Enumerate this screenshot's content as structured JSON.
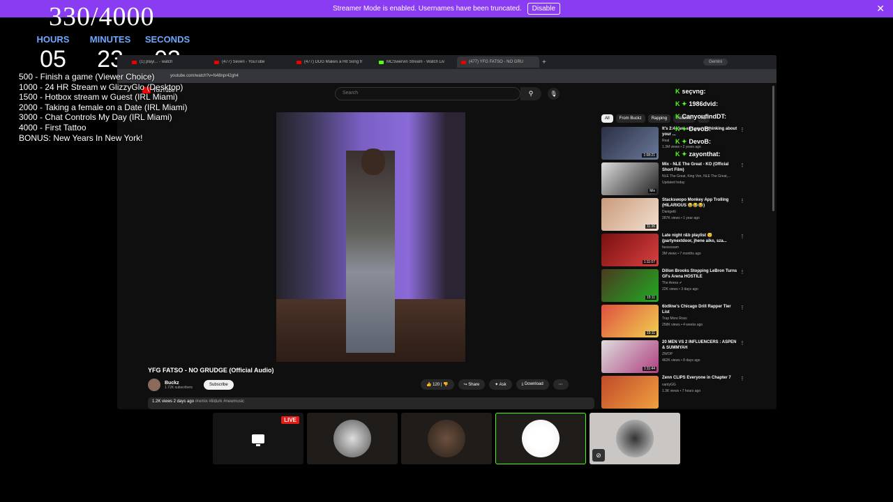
{
  "banner": {
    "text": "Streamer Mode is enabled. Usernames have been truncated.",
    "button": "Disable",
    "close": "✕"
  },
  "goal": {
    "text": "330/4000"
  },
  "timer": {
    "hours_label": "HOURS",
    "minutes_label": "MINUTES",
    "seconds_label": "SECONDS",
    "hours": "05",
    "minutes": "23",
    "seconds": "03"
  },
  "goals": [
    "500 -  Finish a game (Viewer Choice)",
    "1000 - 24 HR Stream w GlizzyGlo (Desktop)",
    "1500 - Hotbox stream w Guest (IRL Miami)",
    "2000 - Taking a female on a Date (IRL Miami)",
    "3000 - Chat Controls My Day (IRL Miami)",
    "4000 - First Tattoo",
    "BONUS: New Years In New York!"
  ],
  "browser": {
    "tabs": [
      "(1) playi... - watch",
      "(477) Seven - YouTube",
      "(477) DDG Makes a Hit Song fr",
      "MCSwervin Stream - Watch Liv",
      "(477) YFG FATSO - NO GRU"
    ],
    "gemini": "Gemini",
    "url": "youtube.com/watch?v=N48npr42gh4"
  },
  "youtube": {
    "logo": "YouTube",
    "search_placeholder": "Search",
    "chips": [
      "All",
      "From Buckz",
      "Rapping",
      "Related",
      "Fo"
    ],
    "video_title": "YFG FATSO - NO GRUDGE (Official Audio)",
    "channel": "Buckz",
    "subs": "1.72K subscribers",
    "subscribe": "Subscribe",
    "likes": "120",
    "share": "Share",
    "ask": "Ask",
    "download": "Download",
    "desc_stats": "1.2K views  2 days ago",
    "desc_tags": "#remix #lildurk #newmusic",
    "sidebar": [
      {
        "title": "It's 2:44 am and you're thinking about your ...",
        "channel": "Real",
        "meta": "1.3M views • 2 years ago",
        "duration": "1:08:21",
        "colors": [
          "#2a2f44",
          "#6a7a9a"
        ]
      },
      {
        "title": "Mix - NLE The Great - KO (Official Short Film)",
        "channel": "NLE The Great, King Von, NLE The Great,...",
        "meta": "Updated today",
        "duration": "Mix",
        "colors": [
          "#ddd",
          "#222"
        ]
      },
      {
        "title": "Stackswopo Monkey App Trolling (HILARIOUS 😂😂😂)",
        "channel": "Danigetti",
        "meta": "287K views • 1 year ago",
        "duration": "11:36",
        "colors": [
          "#c99a7a",
          "#f2e0d0"
        ]
      },
      {
        "title": "Late night r&b playlist 😴 (partynextdoor, jhene aiko, sza...",
        "channel": "fasssosam",
        "meta": "3M views • 7 months ago",
        "duration": "1:11:07",
        "colors": [
          "#7a1010",
          "#d84040"
        ]
      },
      {
        "title": "Dillon Brooks Stopping LeBron Turns GFs Arena HOSTILE",
        "channel": "The Arena ✔",
        "meta": "22K views • 3 days ago",
        "duration": "15:11",
        "colors": [
          "#4a3a20",
          "#22aa22"
        ]
      },
      {
        "title": "6ix9ine's Chicago Drill Rapper Tier List",
        "channel": "Trap More Ross",
        "meta": "258K views • 4 weeks ago",
        "duration": "15:11",
        "colors": [
          "#e05040",
          "#f0d050"
        ]
      },
      {
        "title": "20 MEN VS 2 INFLUENCERS : ASPEN & SUMMYAH",
        "channel": "ZWOP",
        "meta": "462K views • 8 days ago",
        "duration": "1:11:44",
        "colors": [
          "#ddd",
          "#b04080"
        ]
      },
      {
        "title": "Zenn CLIPS Everyone in Chapter 7",
        "channel": "vantyGG",
        "meta": "1.3K views • 7 hours ago",
        "duration": "",
        "colors": [
          "#c04a2a",
          "#f0a040"
        ]
      }
    ]
  },
  "chat": [
    "seçvng:",
    "1986dvid:",
    "CanyoufindDT:",
    "DevoB:",
    "DevoB:",
    "zayonthat:"
  ],
  "tiles": {
    "live": "LIVE"
  }
}
